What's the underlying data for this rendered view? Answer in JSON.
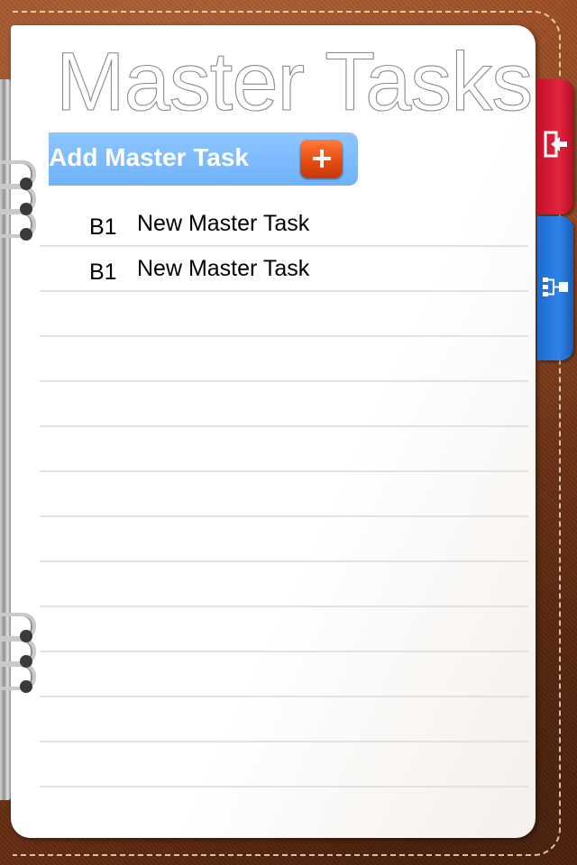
{
  "page": {
    "title": "Master Tasks",
    "add_button_label": "Add Master Task"
  },
  "tasks": [
    {
      "code": "B1",
      "name": "New Master Task"
    },
    {
      "code": "B1",
      "name": "New Master Task"
    }
  ],
  "tabs": [
    {
      "icon": "exit-icon",
      "color": "#d8203a"
    },
    {
      "icon": "hierarchy-icon",
      "color": "#2a7de1"
    }
  ],
  "colors": {
    "add_button": "#7ab9fd",
    "plus_button": "#e8561a",
    "leather": "#7d3918"
  }
}
